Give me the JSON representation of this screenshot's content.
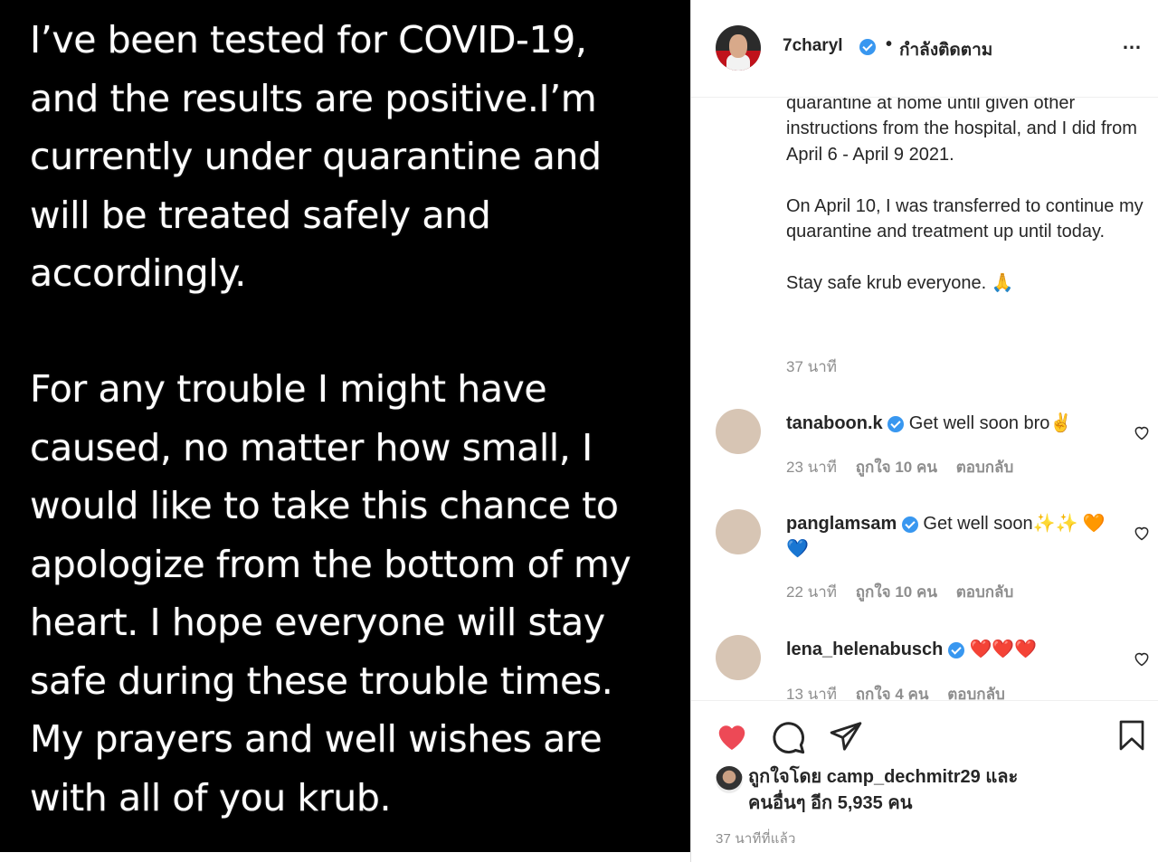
{
  "image": {
    "paragraph1": "I’ve been tested for COVID-19,\nand  the results are positive.I’m\ncurrently under quarantine and\nwill be treated safely and\naccordingly.",
    "paragraph2": "For any trouble I might have\ncaused, no matter how small, I\nwould like to take this chance to\napologize from the bottom of my\nheart. I hope everyone will stay\nsafe during these trouble times.\nMy prayers and well wishes are\nwith all of you krub."
  },
  "header": {
    "username": "7charyl",
    "dot": "•",
    "follow_label": "กำลังติดตาม",
    "more_icon": "…"
  },
  "caption": {
    "text": "quarantine at home until given other instructions from the hospital, and I did from April 6 - April 9 2021.\n\nOn April 10, I was transferred to continue my quarantine and treatment up until today.\n\nStay safe krub everyone. 🙏",
    "time": "37 นาที"
  },
  "comments": [
    {
      "user": "tanaboon.k",
      "text": "Get well soon bro✌️",
      "time": "23 นาที",
      "likes": "ถูกใจ 10 คน",
      "reply": "ตอบกลับ"
    },
    {
      "user": "panglamsam",
      "text": "Get well soon✨✨ 🧡💙",
      "time": "22 นาที",
      "likes": "ถูกใจ 10 คน",
      "reply": "ตอบกลับ"
    },
    {
      "user": "lena_helenabusch",
      "text": "❤️❤️❤️",
      "time": "13 นาที",
      "likes": "ถูกใจ 4 คน",
      "reply": "ตอบกลับ"
    }
  ],
  "footer": {
    "liked_by_prefix": "ถูกใจโดย",
    "liked_by_user": "camp_dechmitr29",
    "liked_by_and": "และ",
    "others": "คนอื่นๆ อีก 5,935 คน",
    "time": "37 นาทีที่แล้ว"
  },
  "colors": {
    "like_red": "#ed4956",
    "verified_blue": "#3897f0",
    "muted_text": "#8e8e8e"
  }
}
